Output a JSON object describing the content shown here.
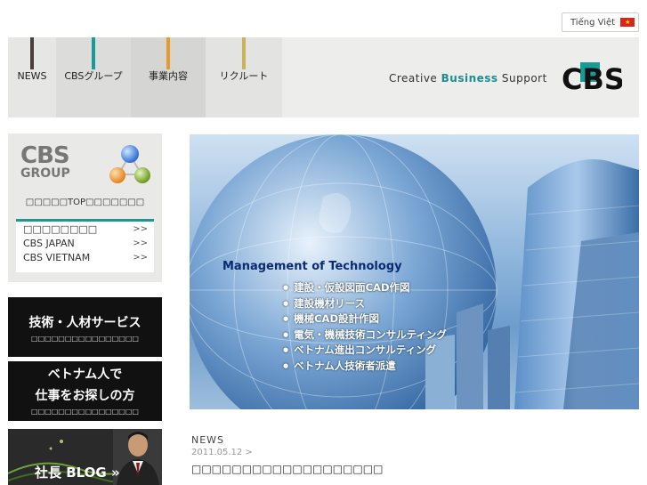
{
  "lang": {
    "label": "Tiếng Việt",
    "flag_icon": "vietnam-flag-icon"
  },
  "nav": [
    {
      "label": "NEWS",
      "color": "#4a3f3a"
    },
    {
      "label": "CBSグループ",
      "color": "#1a9a97"
    },
    {
      "label": "事業内容",
      "color": "#e39b2c"
    },
    {
      "label": "リクルート",
      "color": "#c9b35a"
    }
  ],
  "header": {
    "tagline_pre": "Creative ",
    "tagline_accent": "Business",
    "tagline_post": " Support",
    "logo_text": "CBS"
  },
  "group": {
    "logo_line1": "CBS",
    "logo_line2": "GROUP",
    "top_label": "□□□□□TOP□□□□□□□",
    "links": [
      {
        "label": "□□□□□□□□",
        "arrow": ">>"
      },
      {
        "label": "CBS JAPAN",
        "arrow": ">>"
      },
      {
        "label": "CBS VIETNAM",
        "arrow": ">>"
      }
    ]
  },
  "banners": {
    "service_title": "技術・人材サービス",
    "service_sub": "□□□□□□□□□□□□□□□□",
    "jobs_line1": "ベトナム人で",
    "jobs_line2": "仕事をお探しの方",
    "jobs_sub": "□□□□□□□□□□□□□□□□",
    "blog_label": "社長 BLOG »"
  },
  "hero": {
    "title": "Management of Technology",
    "items": [
      "建設・仮設図面CAD作図",
      "建設機材リース",
      "機械CAD設計作図",
      "電気・機械技術コンサルティング",
      "ベトナム進出コンサルティング",
      "ベトナム人技術者派遣"
    ]
  },
  "news": {
    "heading": "NEWS",
    "date": "2011.05.12 >",
    "title": "□□□□□□□□□□□□□□□□□□□"
  }
}
